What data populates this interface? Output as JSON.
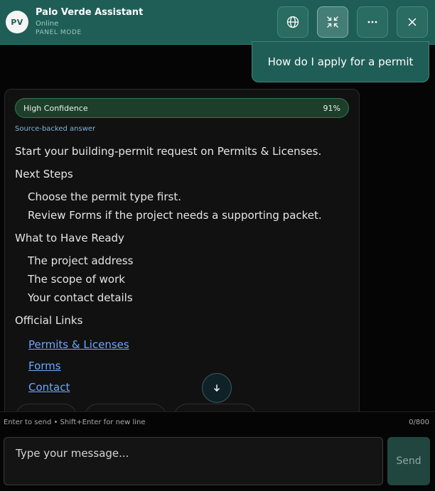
{
  "header": {
    "avatar_initials": "PV",
    "title": "Palo Verde Assistant",
    "status": "Online",
    "mode": "PANEL MODE",
    "buttons": [
      {
        "name": "language-button",
        "icon": "globe-icon"
      },
      {
        "name": "collapse-button",
        "icon": "collapse-arrows-icon"
      },
      {
        "name": "more-button",
        "icon": "ellipsis-icon"
      },
      {
        "name": "close-button",
        "icon": "close-icon"
      }
    ]
  },
  "user_message": "How do I apply for a permit",
  "answer": {
    "confidence_label": "High Confidence",
    "confidence_value": "91%",
    "source_label": "Source-backed answer",
    "intro": "Start your building-permit request on Permits & Licenses.",
    "next_steps_heading": "Next Steps",
    "next_steps": [
      "Choose the permit type first.",
      "Review Forms if the project needs a supporting packet."
    ],
    "ready_heading": "What to Have Ready",
    "ready_items": [
      "The project address",
      "The scope of work",
      "Your contact details"
    ],
    "links_heading": "Official Links",
    "links": [
      "Permits & Licenses",
      "Forms",
      "Contact"
    ]
  },
  "composer": {
    "hint": "Enter to send • Shift+Enter for new line",
    "counter": "0/800",
    "placeholder": "Type your message...",
    "send_label": "Send"
  },
  "colors": {
    "header_bg": "#1f5e56",
    "confidence_bg": "#1d3e2b",
    "link": "#6ea7ff",
    "send_bg": "#21463f"
  }
}
